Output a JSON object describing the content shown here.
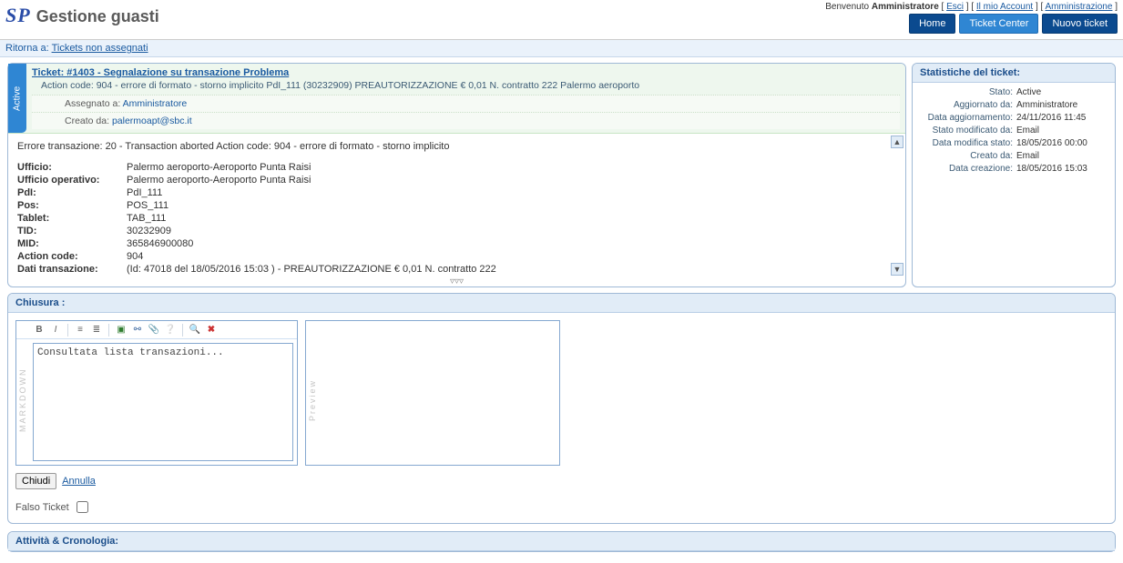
{
  "header": {
    "logo": "SP",
    "title": "Gestione guasti",
    "welcome_prefix": "Benvenuto",
    "user_name": "Amministratore",
    "links": {
      "logout": "Esci",
      "account": "Il mio Account",
      "admin": "Amministrazione"
    },
    "nav": {
      "home": "Home",
      "ticket_center": "Ticket Center",
      "new_ticket": "Nuovo ticket"
    }
  },
  "breadcrumb": {
    "return_label": "Ritorna a:",
    "link": "Tickets non assegnati"
  },
  "ticket": {
    "status_tab": "Active",
    "title": "Ticket: #1403 - Segnalazione su transazione Problema",
    "action_code_line": "Action code: 904 - errore di formato - storno implicito PdI_111 (30232909) PREAUTORIZZAZIONE € 0,01 N. contratto 222 Palermo aeroporto",
    "assigned_label": "Assegnato a:",
    "assigned_value": "Amministratore",
    "created_label": "Creato da:",
    "created_value": "palermoapt@sbc.it",
    "error_line": "Errore transazione: 20 - Transaction aborted Action code: 904 - errore di formato - storno implicito",
    "details": [
      {
        "k": "Ufficio:",
        "v": "Palermo aeroporto-Aeroporto Punta Raisi"
      },
      {
        "k": "Ufficio operativo:",
        "v": "Palermo aeroporto-Aeroporto Punta Raisi"
      },
      {
        "k": "PdI:",
        "v": "PdI_111"
      },
      {
        "k": "Pos:",
        "v": "POS_111"
      },
      {
        "k": "Tablet:",
        "v": "TAB_111"
      },
      {
        "k": "TID:",
        "v": "30232909"
      },
      {
        "k": "MID:",
        "v": "365846900080"
      },
      {
        "k": "Action code:",
        "v": "904"
      },
      {
        "k": "Dati transazione:",
        "v": "(Id: 47018 del 18/05/2016 15:03 ) - PREAUTORIZZAZIONE € 0,01 N. contratto 222"
      }
    ]
  },
  "stats": {
    "title": "Statistiche del ticket:",
    "rows": [
      {
        "k": "Stato:",
        "v": "Active"
      },
      {
        "k": "Aggiornato da:",
        "v": "Amministratore"
      },
      {
        "k": "Data aggiornamento:",
        "v": "24/11/2016 11:45"
      },
      {
        "k": "Stato modificato da:",
        "v": "Email"
      },
      {
        "k": "Data modifica stato:",
        "v": "18/05/2016 00:00"
      },
      {
        "k": "Creato da:",
        "v": "Email"
      },
      {
        "k": "Data creazione:",
        "v": "18/05/2016 15:03"
      }
    ]
  },
  "closure": {
    "title": "Chiusura :",
    "editor_side_label": "MARKDOWN",
    "preview_side_label": "Preview",
    "textarea_value": "Consultata lista transazioni...",
    "close_btn": "Chiudi",
    "cancel_link": "Annulla",
    "falso_label": "Falso Ticket"
  },
  "activity": {
    "title": "Attività & Cronologia:"
  }
}
